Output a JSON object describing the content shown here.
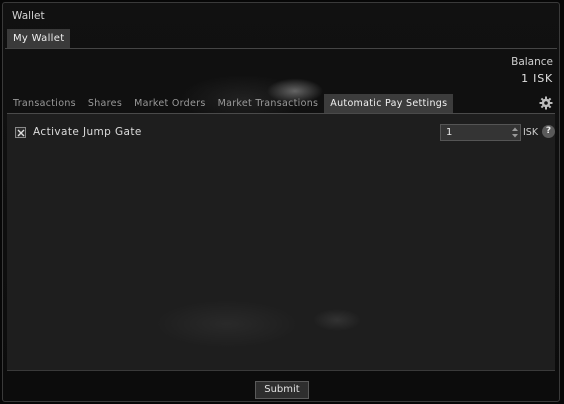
{
  "window": {
    "title": "Wallet"
  },
  "wallet_tab": {
    "label": "My Wallet"
  },
  "balance": {
    "label": "Balance",
    "value": "1 ISK"
  },
  "subtabs": [
    {
      "label": "Transactions",
      "active": false
    },
    {
      "label": "Shares",
      "active": false
    },
    {
      "label": "Market Orders",
      "active": false
    },
    {
      "label": "Market Transactions",
      "active": false
    },
    {
      "label": "Automatic Pay Settings",
      "active": true
    }
  ],
  "settings_icon": "gear-icon",
  "auto_pay": {
    "option_label": "Activate Jump Gate",
    "checked": true,
    "amount": "1",
    "currency": "ISK",
    "help_label": "?"
  },
  "submit_label": "Submit",
  "colors": {
    "active_tab_bg": "#3c3c3c",
    "panel_bg": "#1e1e1e"
  }
}
